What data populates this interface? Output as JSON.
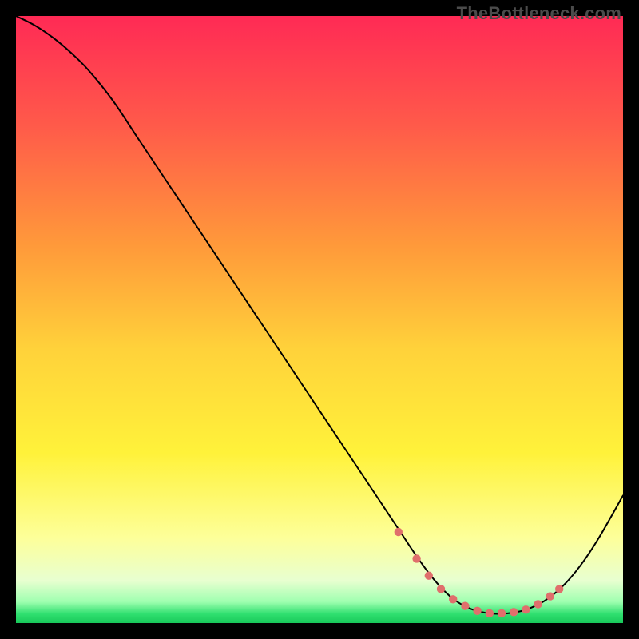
{
  "watermark": "TheBottleneck.com",
  "chart_data": {
    "type": "line",
    "title": "",
    "xlabel": "",
    "ylabel": "",
    "xlim": [
      0,
      100
    ],
    "ylim": [
      0,
      100
    ],
    "series": [
      {
        "name": "curve",
        "color": "#000000",
        "x": [
          0,
          3,
          6,
          9,
          12,
          16,
          20,
          25,
          30,
          35,
          40,
          45,
          50,
          55,
          60,
          63,
          66,
          69,
          72,
          75,
          78,
          81,
          84,
          87,
          90,
          93,
          96,
          100
        ],
        "y": [
          100,
          98.5,
          96.5,
          94,
          91,
          86,
          80,
          72.5,
          65,
          57.5,
          50,
          42.5,
          35,
          27.5,
          20,
          15.5,
          11,
          7,
          4,
          2.3,
          1.6,
          1.6,
          2.2,
          3.6,
          6,
          9.5,
          14,
          21
        ]
      }
    ],
    "markers": {
      "name": "highlight-points",
      "color": "#e06f6c",
      "x": [
        63,
        66,
        68,
        70,
        72,
        74,
        76,
        78,
        80,
        82,
        84,
        86,
        88,
        89.5
      ],
      "y": [
        15.0,
        10.6,
        7.8,
        5.6,
        3.9,
        2.8,
        2.0,
        1.6,
        1.6,
        1.8,
        2.2,
        3.1,
        4.4,
        5.6
      ]
    },
    "gradient_stops": [
      {
        "offset": 0.0,
        "color": "#ff2a55"
      },
      {
        "offset": 0.18,
        "color": "#ff5a4a"
      },
      {
        "offset": 0.38,
        "color": "#ff9a3a"
      },
      {
        "offset": 0.55,
        "color": "#ffd23a"
      },
      {
        "offset": 0.72,
        "color": "#fff23a"
      },
      {
        "offset": 0.86,
        "color": "#fdff9a"
      },
      {
        "offset": 0.93,
        "color": "#e8ffd0"
      },
      {
        "offset": 0.965,
        "color": "#9fffb0"
      },
      {
        "offset": 0.985,
        "color": "#30e070"
      },
      {
        "offset": 1.0,
        "color": "#18c85a"
      }
    ]
  }
}
